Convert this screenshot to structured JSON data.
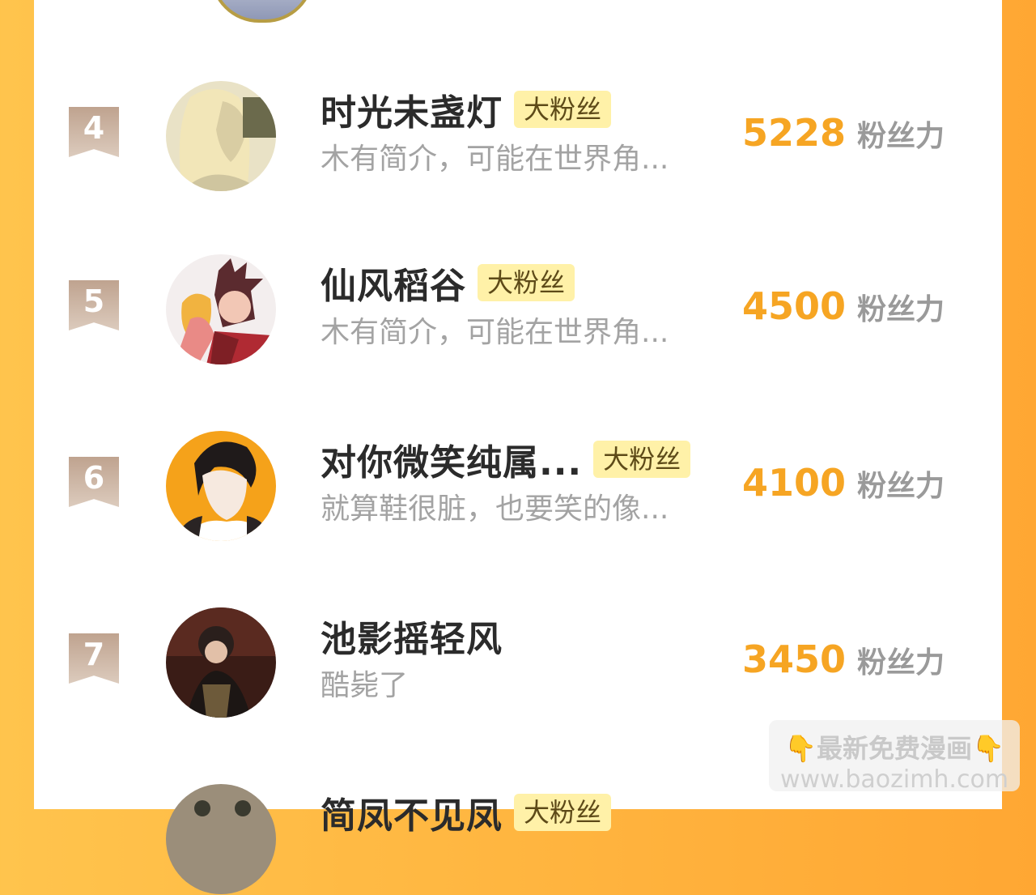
{
  "rows": [
    {
      "rank": "4",
      "name": "时光未盏灯",
      "badge": "大粉丝",
      "bio": "木有简介，可能在世界角...",
      "score": "5228",
      "unit": "粉丝力"
    },
    {
      "rank": "5",
      "name": "仙风稻谷",
      "badge": "大粉丝",
      "bio": "木有简介，可能在世界角...",
      "score": "4500",
      "unit": "粉丝力"
    },
    {
      "rank": "6",
      "name": "对你微笑纯属...",
      "badge": "大粉丝",
      "bio": "就算鞋很脏，也要笑的像...",
      "score": "4100",
      "unit": "粉丝力"
    },
    {
      "rank": "7",
      "name": "池影摇轻风",
      "badge": "",
      "bio": "酷毙了",
      "score": "3450",
      "unit": "粉丝力"
    },
    {
      "rank": "",
      "name": "简凤不见凤",
      "badge": "大粉丝",
      "bio": "",
      "score": "",
      "unit": ""
    }
  ],
  "watermark": {
    "hand_left": "👇",
    "text": "最新免费漫画",
    "hand_right": "👇",
    "url": "www.baozimh.com"
  }
}
